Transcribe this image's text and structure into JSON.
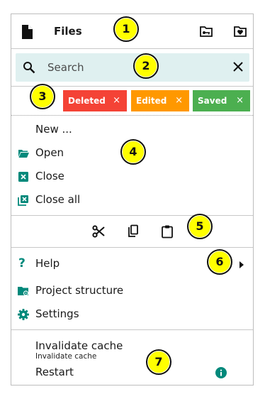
{
  "header": {
    "title": "Files",
    "icons": [
      "file-icon",
      "folder-key-icon",
      "folder-heart-icon"
    ]
  },
  "search": {
    "placeholder": "Search"
  },
  "chips": [
    {
      "label": "Deleted",
      "color": "#f44336",
      "close": "×"
    },
    {
      "label": "Edited",
      "color": "#ff9800",
      "close": "×"
    },
    {
      "label": "Saved",
      "color": "#4caf50",
      "close": "×"
    }
  ],
  "menu": {
    "new": "New ...",
    "open": "Open",
    "close": "Close",
    "close_all": "Close all",
    "help": "Help",
    "project_structure": "Project structure",
    "settings": "Settings",
    "invalidate_cache": "Invalidate cache",
    "invalidate_cache_caption": "Invalidate cache",
    "restart": "Restart"
  },
  "toolbar": {
    "icons": [
      "cut-icon",
      "copy-icon",
      "paste-icon"
    ]
  },
  "badges": [
    "1",
    "2",
    "3",
    "4",
    "5",
    "6",
    "7"
  ],
  "colors": {
    "accent": "#00897b",
    "search_bg": "#dff0f0",
    "badge": "#ffff00"
  }
}
